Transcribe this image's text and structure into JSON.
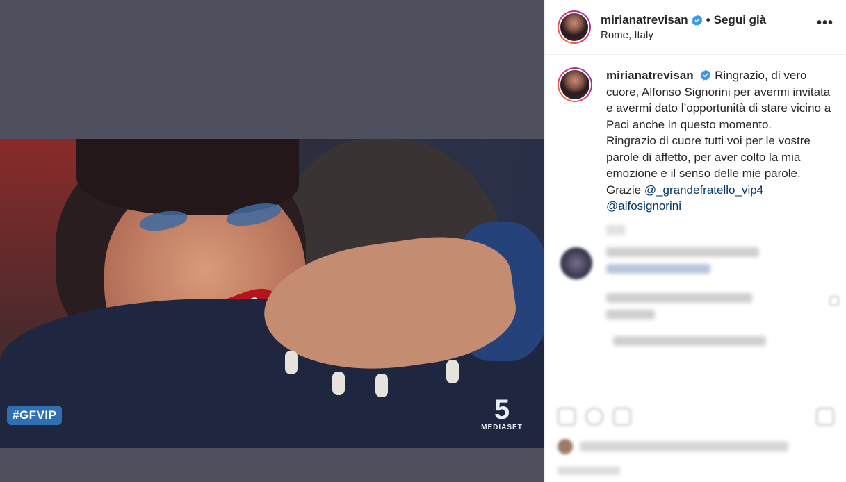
{
  "media": {
    "overlay_tag": "#GFVIP",
    "channel_logo_number": "5",
    "channel_logo_text": "MEDIASET"
  },
  "post_header": {
    "username": "mirianatrevisan",
    "follow_status": "Segui già",
    "location": "Rome, Italy",
    "more_glyph": "•••"
  },
  "caption": {
    "username": "mirianatrevisan",
    "paragraph_1": "Ringrazio, di vero cuore, Alfonso Signorini per avermi invitata e avermi dato l’opportunità di stare vicino a Paci anche in questo momento.",
    "paragraph_2": "Ringrazio di cuore tutti voi per le vostre parole di affetto, per aver colto la mia emozione e il senso delle mie parole.",
    "grazie": "Grazie",
    "mention_1": "@_grandefratello_vip4",
    "mention_2": "@alfosignorini"
  },
  "colors": {
    "verified_badge": "#3897f0",
    "mention": "#00376b",
    "tag_background": "#2f6fb4"
  },
  "icons": {
    "verified": "verified-badge-icon",
    "more": "more-options-icon"
  }
}
